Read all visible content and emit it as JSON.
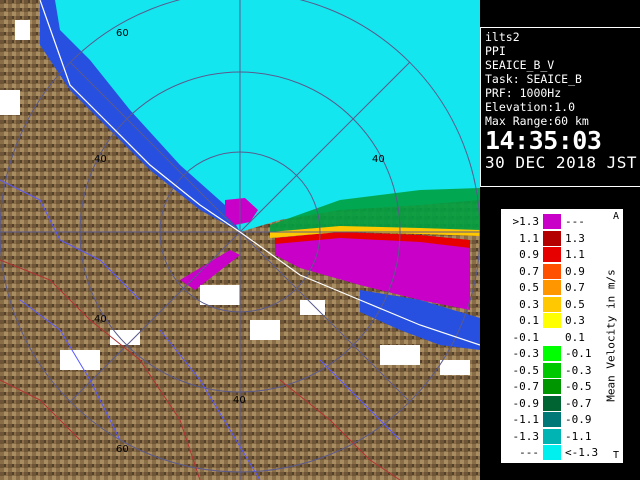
{
  "info": {
    "site": "ilts2",
    "product": "PPI",
    "param": "SEAICE_B_V",
    "task": "Task: SEAICE_B",
    "prf": "PRF: 1000Hz",
    "elevation": "Elevation:1.0",
    "max_range": "Max Range:60 km",
    "time": "14:35:03",
    "date": "30 DEC 2018 JST"
  },
  "range_labels": [
    "60",
    "40",
    "40",
    "40",
    "40",
    "60"
  ],
  "legend": {
    "title": "Mean Velocity in m/s",
    "top_arrow": "A",
    "bottom_arrow": "T",
    "rows": [
      {
        "lo": ">1.3",
        "hi": "---",
        "color": "#c800c8"
      },
      {
        "lo": "1.1",
        "hi": "1.3",
        "color": "#b40000"
      },
      {
        "lo": "0.9",
        "hi": "1.1",
        "color": "#e60000"
      },
      {
        "lo": "0.7",
        "hi": "0.9",
        "color": "#ff5000"
      },
      {
        "lo": "0.5",
        "hi": "0.7",
        "color": "#ff9600"
      },
      {
        "lo": "0.3",
        "hi": "0.5",
        "color": "#ffc800"
      },
      {
        "lo": "0.1",
        "hi": "0.3",
        "color": "#ffff00"
      },
      {
        "lo": "-0.1",
        "hi": "0.1",
        "color": "#ffffff"
      },
      {
        "lo": "-0.3",
        "hi": "-0.1",
        "color": "#00ff00"
      },
      {
        "lo": "-0.5",
        "hi": "-0.3",
        "color": "#00c800"
      },
      {
        "lo": "-0.7",
        "hi": "-0.5",
        "color": "#009600"
      },
      {
        "lo": "-0.9",
        "hi": "-0.7",
        "color": "#006432"
      },
      {
        "lo": "-1.1",
        "hi": "-0.9",
        "color": "#007878"
      },
      {
        "lo": "-1.3",
        "hi": "-1.1",
        "color": "#00b4b4"
      },
      {
        "lo": "---",
        "hi": "<-1.3",
        "color": "#00f0f0"
      }
    ]
  }
}
